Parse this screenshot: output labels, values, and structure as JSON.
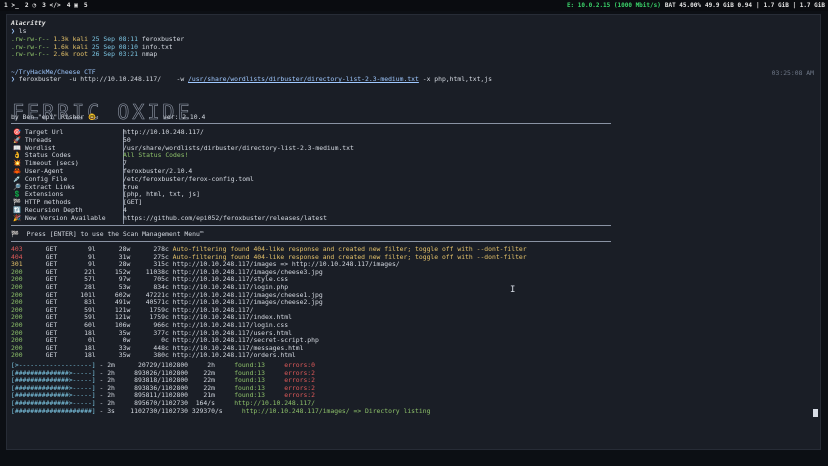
{
  "topbar": {
    "workspaces": [
      "1 ≻_",
      "2 ◔",
      "3 </>",
      "4 ▣",
      "5"
    ],
    "network": "E: 10.0.2.15 (1000 Mbit/s)",
    "battery": "BAT 45.00%",
    "memory": "49.9 GiB 0.94",
    "sep": "|",
    "disk": "1.7 GiB | 1.7 GiB"
  },
  "terminal": {
    "title": "Alacritty",
    "cmd1_prompt": "❯",
    "cmd1": "ls",
    "ls_lines": [
      {
        "perm": ".rw-rw-r--",
        "size": "1.3k",
        "user": "kali",
        "date": "25 Sep 08:11",
        "name": "feroxbuster"
      },
      {
        "perm": ".rw-rw-r--",
        "size": "1.6k",
        "user": "kali",
        "date": "25 Sep 08:10",
        "name": "info.txt"
      },
      {
        "perm": ".rw-rw-r--",
        "size": "2.6k",
        "user": "root",
        "date": "26 Sep 03:21",
        "name": "nmap"
      }
    ],
    "cwd": "~/TryHackMe/Cheese CTF",
    "timestamp": "03:25:08 AM",
    "cmd2_prompt": "❯",
    "cmd2_prefix": "feroxbuster  -u http://10.10.248.117/    -w ",
    "cmd2_wordlist": "/usr/share/wordlists/dirbuster/directory-list-2.3-medium.txt",
    "cmd2_suffix": " -x php,html,txt,js",
    "banner_text": "FERRIC OXIDE",
    "byline": "by Ben \"epi\" Risher 🤓",
    "version": "ver: 2.10.4"
  },
  "config": [
    {
      "icon": "🎯",
      "label": "Target Url",
      "value": "http://10.10.248.117/",
      "cls": "w"
    },
    {
      "icon": "🚀",
      "label": "Threads",
      "value": "50",
      "cls": "w"
    },
    {
      "icon": "📖",
      "label": "Wordlist",
      "value": "/usr/share/wordlists/dirbuster/directory-list-2.3-medium.txt",
      "cls": "w"
    },
    {
      "icon": "👌",
      "label": "Status Codes",
      "value": "All Status Codes!",
      "cls": "g"
    },
    {
      "icon": "💥",
      "label": "Timeout (secs)",
      "value": "7",
      "cls": "w"
    },
    {
      "icon": "🦀",
      "label": "User-Agent",
      "value": "feroxbuster/2.10.4",
      "cls": "w"
    },
    {
      "icon": "💉",
      "label": "Config File",
      "value": "/etc/feroxbuster/ferox-config.toml",
      "cls": "w"
    },
    {
      "icon": "🔎",
      "label": "Extract Links",
      "value": "true",
      "cls": "w"
    },
    {
      "icon": "💲",
      "label": "Extensions",
      "value": "[php, html, txt, js]",
      "cls": "w"
    },
    {
      "icon": "🏁",
      "label": "HTTP methods",
      "value": "[GET]",
      "cls": "w"
    },
    {
      "icon": "🔃",
      "label": "Recursion Depth",
      "value": "4",
      "cls": "w"
    },
    {
      "icon": "🎉",
      "label": "New Version Available",
      "value": "https://github.com/epi052/feroxbuster/releases/latest",
      "cls": "w"
    }
  ],
  "scan_menu": "🏁  Press [ENTER] to use the Scan Management Menu™",
  "results": [
    {
      "code": "403",
      "method": "GET",
      "lines": "9l",
      "words": "28w",
      "chars": "278c",
      "text": "Auto-filtering found 404-like response and created new filter; toggle off with --dont-filter",
      "cc": "r"
    },
    {
      "code": "404",
      "method": "GET",
      "lines": "9l",
      "words": "31w",
      "chars": "275c",
      "text": "Auto-filtering found 404-like response and created new filter; toggle off with --dont-filter",
      "cc": "r"
    },
    {
      "code": "301",
      "method": "GET",
      "lines": "9l",
      "words": "28w",
      "chars": "315c",
      "text": "http://10.10.248.117/images => http://10.10.248.117/images/",
      "cc": "y"
    },
    {
      "code": "200",
      "method": "GET",
      "lines": "22l",
      "words": "152w",
      "chars": "11038c",
      "text": "http://10.10.248.117/images/cheese3.jpg",
      "cc": "g"
    },
    {
      "code": "200",
      "method": "GET",
      "lines": "57l",
      "words": "97w",
      "chars": "705c",
      "text": "http://10.10.248.117/style.css",
      "cc": "g"
    },
    {
      "code": "200",
      "method": "GET",
      "lines": "28l",
      "words": "53w",
      "chars": "834c",
      "text": "http://10.10.248.117/login.php",
      "cc": "g"
    },
    {
      "code": "200",
      "method": "GET",
      "lines": "101l",
      "words": "602w",
      "chars": "47221c",
      "text": "http://10.10.248.117/images/cheese1.jpg",
      "cc": "g"
    },
    {
      "code": "200",
      "method": "GET",
      "lines": "83l",
      "words": "491w",
      "chars": "40571c",
      "text": "http://10.10.248.117/images/cheese2.jpg",
      "cc": "g"
    },
    {
      "code": "200",
      "method": "GET",
      "lines": "59l",
      "words": "121w",
      "chars": "1759c",
      "text": "http://10.10.248.117/",
      "cc": "g"
    },
    {
      "code": "200",
      "method": "GET",
      "lines": "59l",
      "words": "121w",
      "chars": "1759c",
      "text": "http://10.10.248.117/index.html",
      "cc": "g"
    },
    {
      "code": "200",
      "method": "GET",
      "lines": "60l",
      "words": "106w",
      "chars": "966c",
      "text": "http://10.10.248.117/login.css",
      "cc": "g"
    },
    {
      "code": "200",
      "method": "GET",
      "lines": "18l",
      "words": "35w",
      "chars": "377c",
      "text": "http://10.10.248.117/users.html",
      "cc": "g"
    },
    {
      "code": "200",
      "method": "GET",
      "lines": "0l",
      "words": "0w",
      "chars": "0c",
      "text": "http://10.10.248.117/secret-script.php",
      "cc": "g"
    },
    {
      "code": "200",
      "method": "GET",
      "lines": "18l",
      "words": "33w",
      "chars": "448c",
      "text": "http://10.10.248.117/messages.html",
      "cc": "g"
    },
    {
      "code": "200",
      "method": "GET",
      "lines": "18l",
      "words": "35w",
      "chars": "380c",
      "text": "http://10.10.248.117/orders.html",
      "cc": "g"
    }
  ],
  "progress": [
    {
      "bar": "[>-------------------]",
      "time": "- 2m",
      "count": "20729/1102800",
      "rate": "2h",
      "found": "found:13",
      "errors": "errors:0"
    },
    {
      "bar": "[##############>-----]",
      "time": "- 2h",
      "count": "893026/1102800",
      "rate": "22m",
      "found": "found:13",
      "errors": "errors:2"
    },
    {
      "bar": "[##############>-----]",
      "time": "- 2h",
      "count": "893818/1102800",
      "rate": "22m",
      "found": "found:13",
      "errors": "errors:2"
    },
    {
      "bar": "[##############>-----]",
      "time": "- 2h",
      "count": "893836/1102800",
      "rate": "22m",
      "found": "found:13",
      "errors": "errors:2"
    },
    {
      "bar": "[##############>-----]",
      "time": "- 2h",
      "count": "895811/1102800",
      "rate": "21m",
      "found": "found:13",
      "errors": "errors:2"
    },
    {
      "bar": "[##############>-----]",
      "time": "- 2h",
      "count": "895670/1102730",
      "rate": "164/s",
      "found": "http://10.10.248.117/",
      "errors": ""
    },
    {
      "bar": "[####################]",
      "time": "- 3s",
      "count": "1102730/1102730",
      "rate": "329370/s",
      "found": "http://10.10.248.117/images/ => Directory listing",
      "errors": ""
    }
  ]
}
